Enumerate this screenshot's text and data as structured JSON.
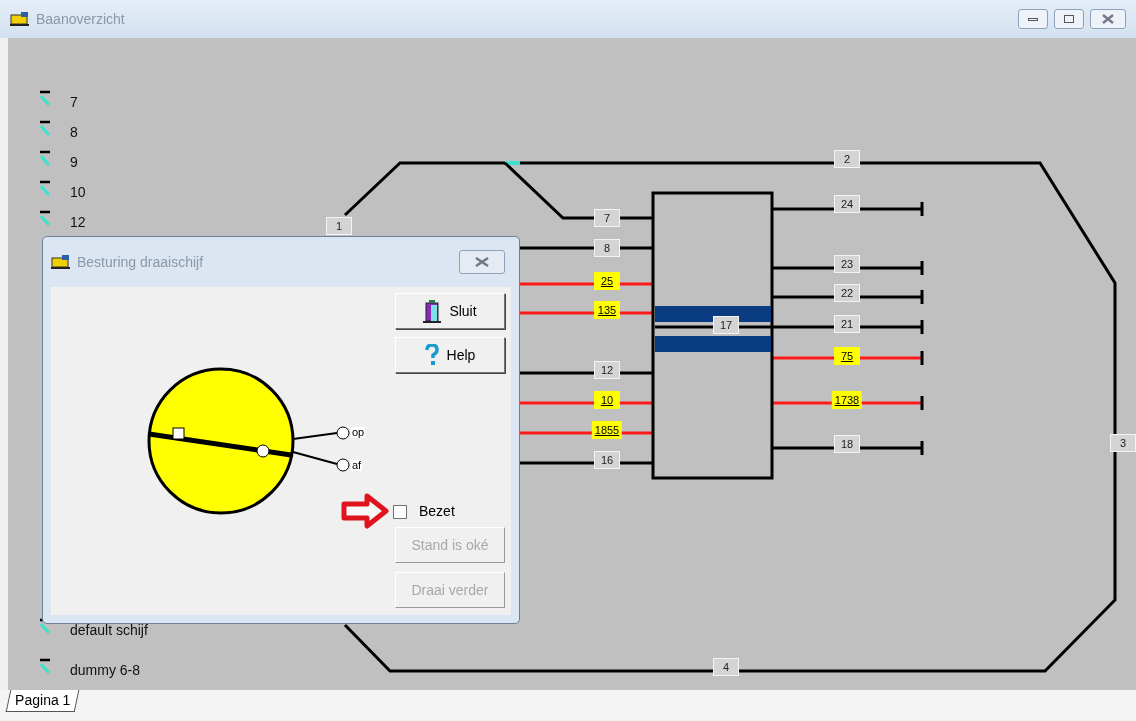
{
  "window": {
    "title": "Baanoverzicht"
  },
  "legend": [
    {
      "label": "7"
    },
    {
      "label": "8"
    },
    {
      "label": "9"
    },
    {
      "label": "10"
    },
    {
      "label": "12"
    },
    {
      "label": "default schijf"
    },
    {
      "label": "dummy 6-8"
    }
  ],
  "blocks": [
    {
      "label": "2",
      "occupied": false
    },
    {
      "label": "24",
      "occupied": false
    },
    {
      "label": "7",
      "occupied": false
    },
    {
      "label": "1",
      "occupied": false
    },
    {
      "label": "8",
      "occupied": false
    },
    {
      "label": "23",
      "occupied": false
    },
    {
      "label": "25",
      "occupied": true
    },
    {
      "label": "22",
      "occupied": false
    },
    {
      "label": "135",
      "occupied": true
    },
    {
      "label": "17",
      "occupied": false
    },
    {
      "label": "21",
      "occupied": false
    },
    {
      "label": "75",
      "occupied": true
    },
    {
      "label": "12",
      "occupied": false
    },
    {
      "label": "10",
      "occupied": true
    },
    {
      "label": "1738",
      "occupied": true
    },
    {
      "label": "1855",
      "occupied": true
    },
    {
      "label": "18",
      "occupied": false
    },
    {
      "label": "3",
      "occupied": false
    },
    {
      "label": "16",
      "occupied": false
    },
    {
      "label": "4",
      "occupied": false
    }
  ],
  "dialog": {
    "title": "Besturing draaischijf",
    "buttons": [
      {
        "label": "Sluit",
        "kind": "close"
      },
      {
        "label": "Help",
        "kind": "help"
      }
    ],
    "exits": [
      {
        "label": "op"
      },
      {
        "label": "af"
      }
    ],
    "checkbox": {
      "label": "Bezet",
      "checked": false
    },
    "actions": [
      {
        "label": "Stand is oké",
        "disabled": true
      },
      {
        "label": "Draai verder",
        "disabled": true
      }
    ]
  },
  "tabs": [
    {
      "label": "Pagina 1",
      "selected": true
    }
  ]
}
